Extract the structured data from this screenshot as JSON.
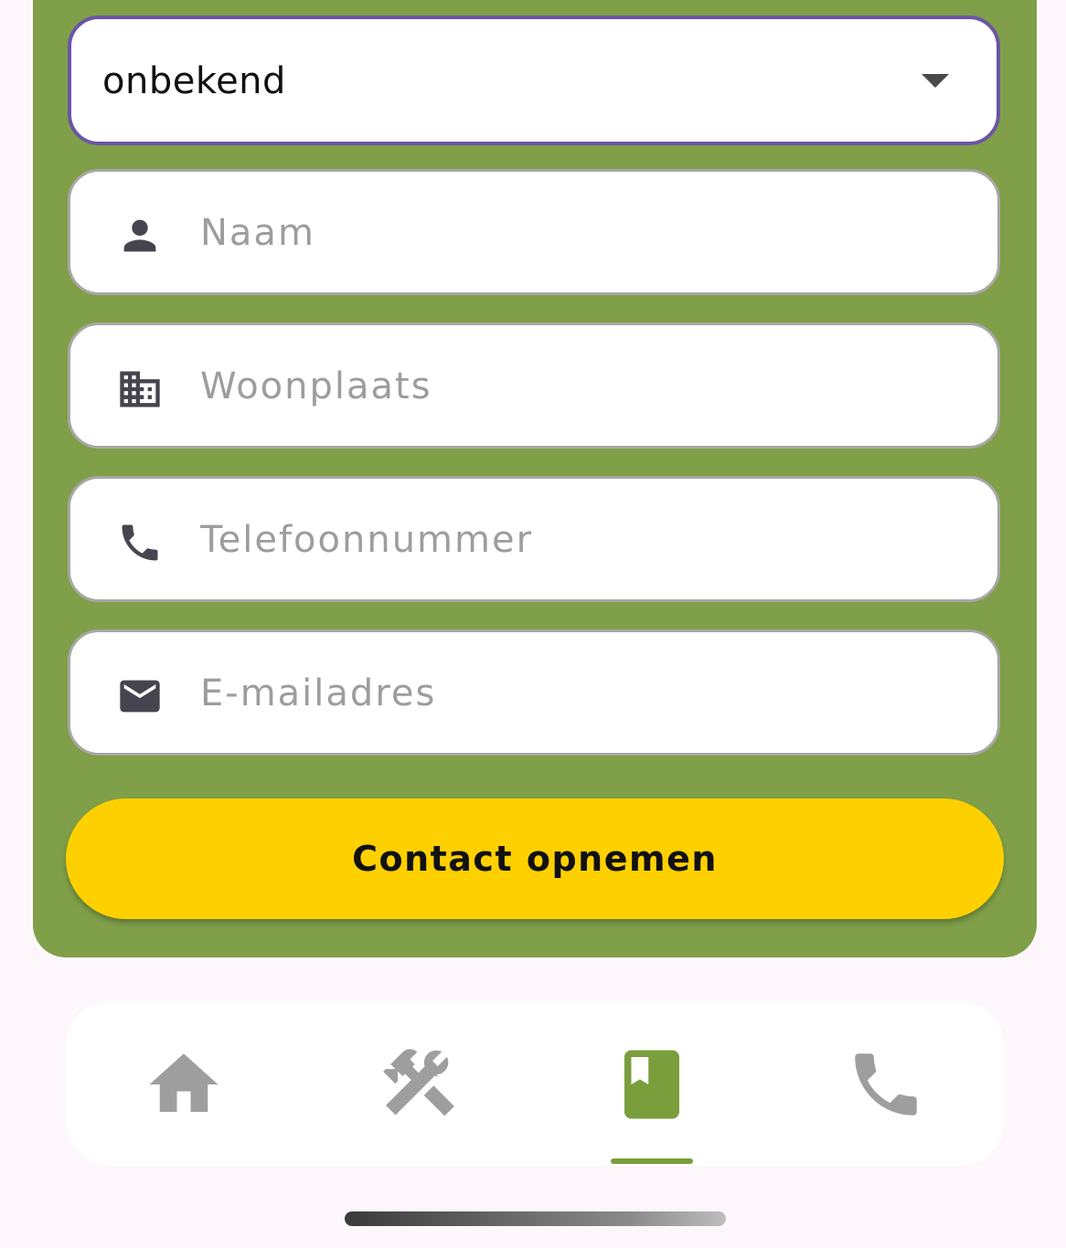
{
  "form": {
    "select": {
      "value": "onbekend",
      "icon": "arrow-drop-down-icon"
    },
    "fields": [
      {
        "placeholder": "Naam",
        "value": "",
        "icon": "person-icon"
      },
      {
        "placeholder": "Woonplaats",
        "value": "",
        "icon": "building-icon"
      },
      {
        "placeholder": "Telefoonnummer",
        "value": "",
        "icon": "phone-icon"
      },
      {
        "placeholder": "E-mailadres",
        "value": "",
        "icon": "mail-icon"
      }
    ],
    "submit_label": "Contact opnemen"
  },
  "bottom_nav": {
    "items": [
      {
        "icon": "home-icon",
        "active": false
      },
      {
        "icon": "tools-icon",
        "active": false
      },
      {
        "icon": "book-icon",
        "active": true
      },
      {
        "icon": "phone-icon",
        "active": false
      }
    ]
  },
  "colors": {
    "panel": "#7f9f48",
    "button": "#ffd000",
    "select_border": "#6a55a6",
    "nav_active": "#7a9e3c",
    "nav_inactive": "#9e9e9e",
    "page_background": "#fdf7fc"
  }
}
